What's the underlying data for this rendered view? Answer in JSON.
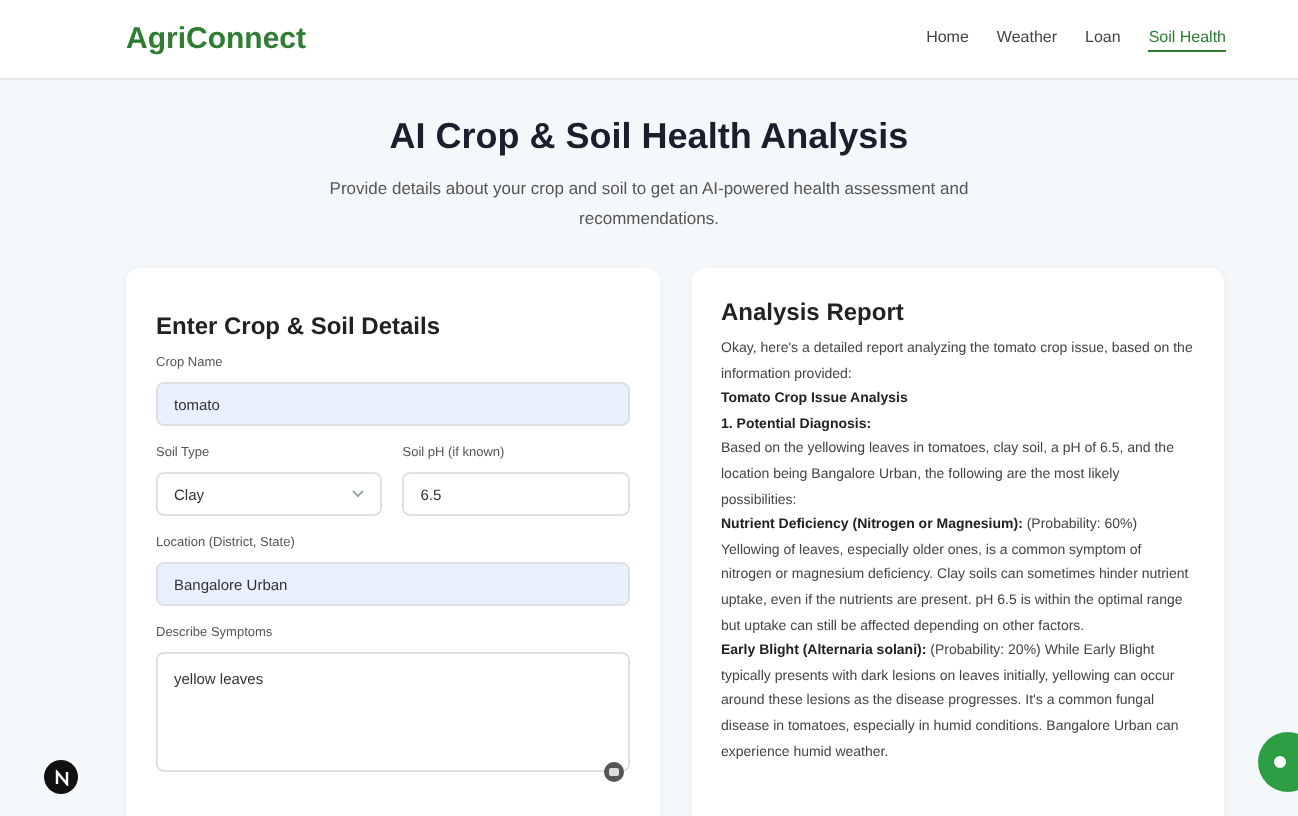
{
  "header": {
    "logo": "AgriConnect",
    "nav": [
      {
        "label": "Home",
        "selected": false
      },
      {
        "label": "Weather",
        "selected": false
      },
      {
        "label": "Loan",
        "selected": false
      },
      {
        "label": "Soil Health",
        "selected": true
      }
    ]
  },
  "hero": {
    "title": "AI Crop & Soil Health Analysis",
    "subtitle": "Provide details about your crop and soil to get an AI-powered health assessment and recommendations."
  },
  "form": {
    "title": "Enter Crop & Soil Details",
    "fields": [
      {
        "label": "Crop Name",
        "value": "tomato",
        "kind": "input",
        "autofilled": true
      },
      {
        "label": "Soil Type",
        "value": "Clay",
        "kind": "select",
        "autofilled": false
      },
      {
        "label": "Soil pH (if known)",
        "value": "6.5",
        "kind": "input",
        "autofilled": false
      },
      {
        "label": "Location (District, State)",
        "value": "Bangalore Urban",
        "kind": "input",
        "autofilled": true
      },
      {
        "label": "Describe Symptoms",
        "value": "yellow leaves",
        "kind": "textarea",
        "autofilled": false
      }
    ]
  },
  "report": {
    "title": "Analysis Report",
    "paragraphs": [
      {
        "kind": "text",
        "text": "Okay, here's a detailed report analyzing the tomato crop issue, based on the information provided:"
      },
      {
        "kind": "heading",
        "text": "Tomato Crop Issue Analysis"
      },
      {
        "kind": "heading",
        "text": "1. Potential Diagnosis:"
      },
      {
        "kind": "text",
        "text": "Based on the yellowing leaves in tomatoes, clay soil, a pH of 6.5, and the location being Bangalore Urban, the following are the most likely possibilities:"
      },
      {
        "kind": "text",
        "text": "**Nutrient Deficiency (Nitrogen or Magnesium):** (Probability: 60%) Yellowing of leaves, especially older ones, is a common symptom of nitrogen or magnesium deficiency. Clay soils can sometimes hinder nutrient uptake, even if the nutrients are present. pH 6.5 is within the optimal range but uptake can still be affected depending on other factors."
      },
      {
        "kind": "text",
        "text": "**Early Blight (Alternaria solani):** (Probability: 20%) While Early Blight typically presents with dark lesions on leaves initially, yellowing can occur around these lesions as the disease progresses. It's a common fungal disease in tomatoes, especially in humid conditions. Bangalore Urban can experience humid weather."
      }
    ]
  }
}
